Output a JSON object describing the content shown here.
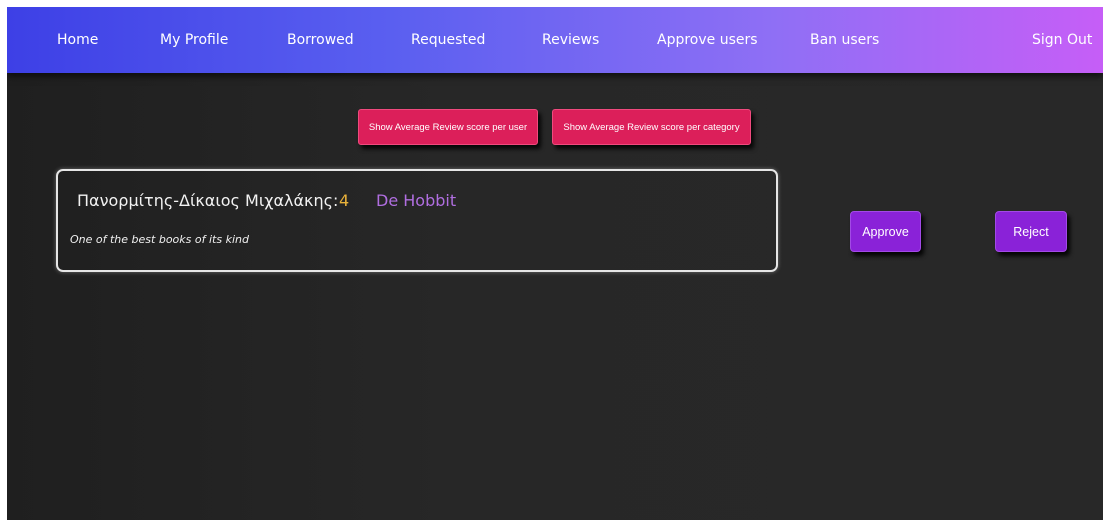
{
  "navbar": {
    "items": [
      {
        "label": "Home"
      },
      {
        "label": "My Profile"
      },
      {
        "label": "Borrowed"
      },
      {
        "label": "Requested"
      },
      {
        "label": "Reviews"
      },
      {
        "label": "Approve users"
      },
      {
        "label": "Ban users"
      }
    ],
    "sign_out": "Sign Out"
  },
  "actions": {
    "avg_per_user": "Show Average Review score per user",
    "avg_per_category": "Show Average Review score per category"
  },
  "review": {
    "reviewer": "Πανορμίτης-Δίκαιος Μιχαλάκης:",
    "score": "4",
    "book": "De Hobbit",
    "text": "One of the best books of its kind",
    "approve_label": "Approve",
    "reject_label": "Reject"
  },
  "colors": {
    "accent_pink": "#dc1f5a",
    "accent_purple": "#8a22d8",
    "score": "#e8b13a",
    "book_title": "#b06ee0"
  }
}
